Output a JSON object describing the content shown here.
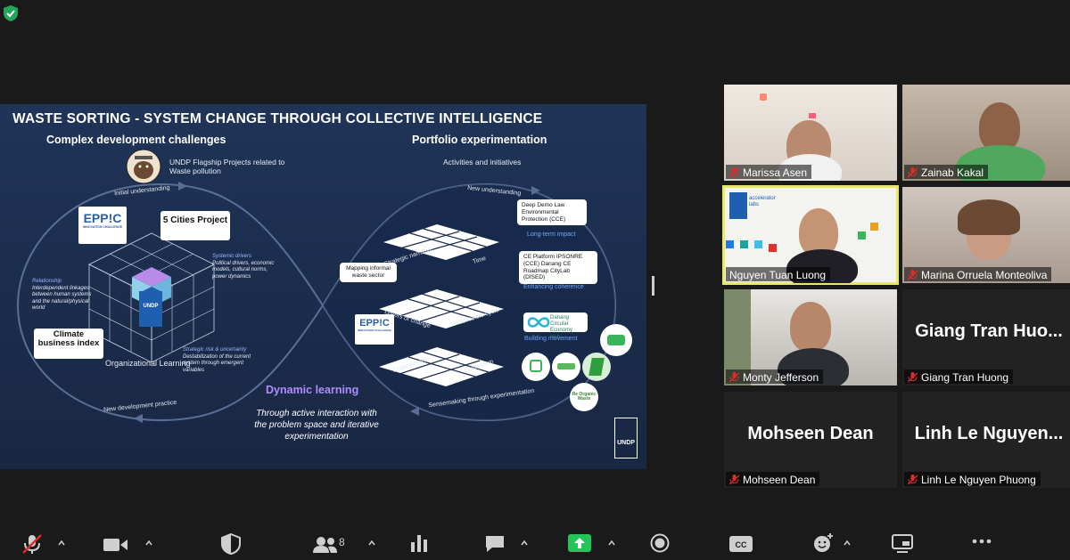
{
  "slide": {
    "title": "WASTE SORTING - SYSTEM CHANGE THROUGH COLLECTIVE INTELLIGENCE",
    "left_subtitle": "Complex development challenges",
    "right_subtitle": "Portfolio experimentation",
    "flagship": "UNDP Flagship Projects related to Waste pollution",
    "activities": "Activities and initiatives",
    "initial_understanding": "Initial understanding",
    "new_understanding": "New understanding",
    "new_dev_practice": "New development practice",
    "sensemaking": "Sensemaking through experimentation",
    "five_cities": "5 Cities Project",
    "climate_index": "Climate business index",
    "org_learning": "Organizational Learning",
    "mapping": "Mapping informal waste sector",
    "systemic_title": "Systemic drivers",
    "systemic_body": "Political drivers, economic models, cultural norms, power dynamics",
    "relationship_title": "Relationship",
    "relationship_body": "Interdependent linkages between human systems and the natural/physical world",
    "risk_title": "Strategic risk & uncertainty",
    "risk_body": "Destabilization of the current system through emergent variables",
    "card1": "Deep Demo Law Environmental Protection (CCE)",
    "tag1": "Long-term impact",
    "card2": "CE Platform IPSONRE (CCE) Danang CE Roadmap CityLab (DISED)",
    "tag2": "Enhancing coherence",
    "card3": "Danang Circular Economy Hub",
    "tag3": "Building movement",
    "layer_strategic": "Strategic narrative",
    "layer_time": "Time",
    "layer_levers": "Levers of change",
    "layer_plastics": "Plastics life cycle",
    "layer_engagement": "Engagement",
    "layer_ecosystem": "Ecosystem",
    "dynamic": "Dynamic learning",
    "through": "Through active interaction with the problem space and iterative experimentation",
    "epic_big": "EPP!C",
    "epic_small": "INNOVATION CHALLENGE",
    "undp": "UNDP",
    "reorganic": "Re Organic Waste"
  },
  "participants": [
    {
      "name": "Marissa Asen",
      "muted": true
    },
    {
      "name": "Zainab Kakal",
      "muted": true
    },
    {
      "name": "Nguyen Tuan Luong",
      "muted": false,
      "active": true
    },
    {
      "name": "Marina Orruela Monteoliva",
      "muted": true
    },
    {
      "name": "Monty Jefferson",
      "muted": true
    },
    {
      "name": "Giang Tran Huong",
      "muted": true,
      "display": "Giang Tran Huo..."
    },
    {
      "name": "Mohseen Dean",
      "muted": true,
      "display": "Mohseen Dean"
    },
    {
      "name": "Linh Le Nguyen Phuong",
      "muted": true,
      "display": "Linh Le Nguyen..."
    }
  ],
  "accelerator": "accelerator labs",
  "toolbar": {
    "participants_count": "8"
  }
}
